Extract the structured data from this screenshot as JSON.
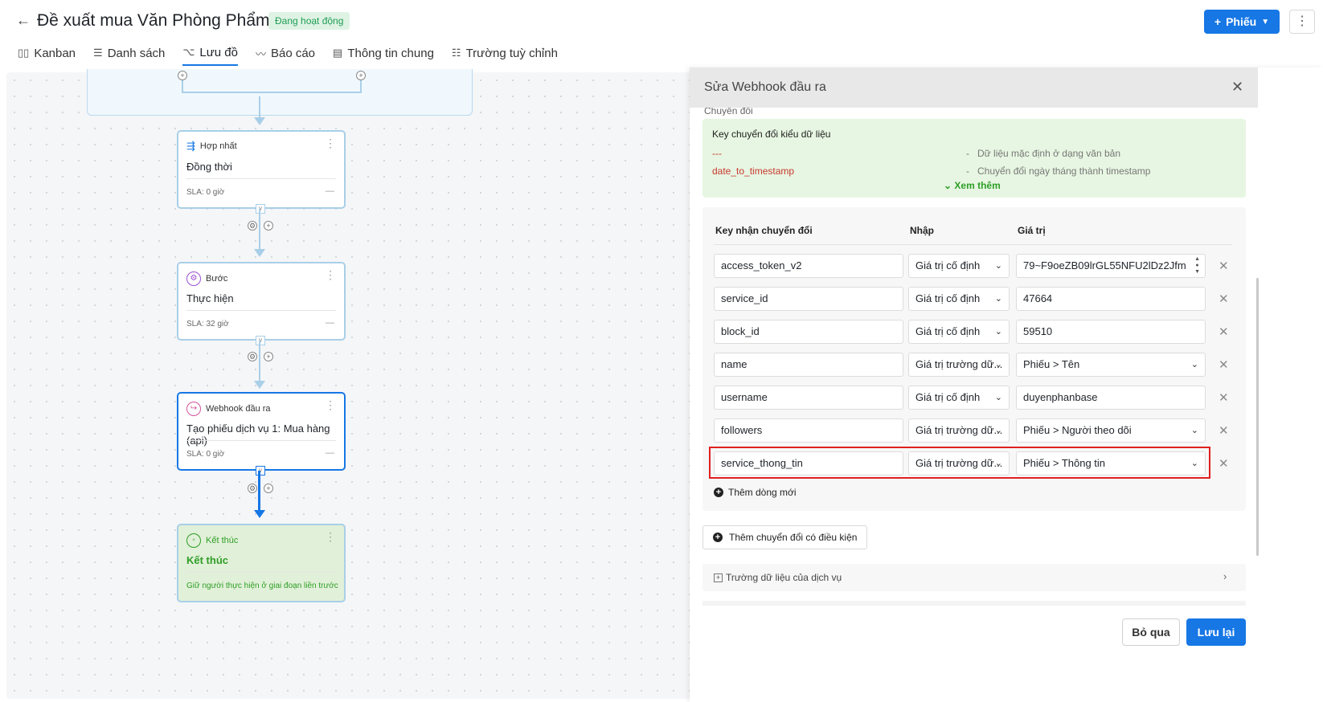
{
  "header": {
    "back_icon": "arrow-left-icon",
    "title": "Đề xuất mua Văn Phòng Phẩm",
    "status": "Đang hoạt động",
    "add_button": "Phiếu",
    "tabs": [
      {
        "label": "Kanban",
        "icon": "kanban-icon"
      },
      {
        "label": "Danh sách",
        "icon": "list-icon"
      },
      {
        "label": "Lưu đồ",
        "icon": "flowchart-icon",
        "active": true
      },
      {
        "label": "Báo cáo",
        "icon": "chart-icon"
      },
      {
        "label": "Thông tin chung",
        "icon": "info-icon"
      },
      {
        "label": "Trường tuỳ chỉnh",
        "icon": "custom-fields-icon"
      }
    ]
  },
  "flow": {
    "nodes": [
      {
        "type": "Hợp nhất",
        "title": "Đồng thời",
        "sla": "SLA: 0 giờ"
      },
      {
        "type": "Bước",
        "title": "Thực hiện",
        "sla": "SLA: 32 giờ"
      },
      {
        "type": "Webhook đầu ra",
        "title": "Tạo phiếu dịch vụ 1: Mua hàng (api)",
        "sla": "SLA: 0 giờ"
      },
      {
        "type": "Kết thúc",
        "title": "Kết thúc",
        "desc": "Giữ người thực hiện ở giai đoạn liền trước"
      }
    ]
  },
  "panel": {
    "title": "Sửa Webhook đầu ra",
    "cutoff_label": "Chuyển đổi",
    "info": {
      "title": "Key chuyển đổi kiểu dữ liệu",
      "rows": [
        {
          "key": "---",
          "desc": "Dữ liệu mặc định ở dạng văn bản"
        },
        {
          "key": "date_to_timestamp",
          "desc": "Chuyển đổi ngày tháng thành timestamp"
        }
      ],
      "more": "Xem thêm"
    },
    "mapping": {
      "headers": {
        "key": "Key nhận chuyển đổi",
        "input": "Nhập",
        "value": "Giá trị"
      },
      "rows": [
        {
          "key": "access_token_v2",
          "input": "Giá trị cố định",
          "value": "79~F9oeZB09lrGL55NFU2lDz2Jfm"
        },
        {
          "key": "service_id",
          "input": "Giá trị cố định",
          "value": "47664"
        },
        {
          "key": "block_id",
          "input": "Giá trị cố định",
          "value": "59510"
        },
        {
          "key": "name",
          "input": "Giá trị trường dữ...",
          "value": "Phiếu > Tên"
        },
        {
          "key": "username",
          "input": "Giá trị cố định",
          "value": "duyenphanbase"
        },
        {
          "key": "followers",
          "input": "Giá trị trường dữ...",
          "value": "Phiếu > Người theo dõi"
        },
        {
          "key": "service_thong_tin",
          "input": "Giá trị trường dữ...",
          "value": "Phiếu > Thông tin"
        }
      ],
      "add_row": "Thêm dòng mới"
    },
    "add_conditional": "Thêm chuyển đổi có điều kiện",
    "service_fields": "Trường dữ liệu của dịch vụ",
    "cancel": "Bỏ qua",
    "save": "Lưu lại"
  }
}
